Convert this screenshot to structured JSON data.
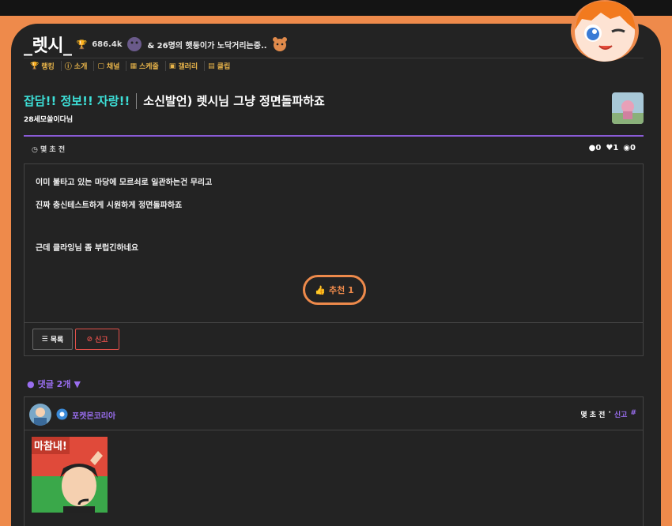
{
  "header": {
    "channel_name": "_렛시_",
    "follow_count": "686.4k",
    "viewers_text": "& 26명의 햇둥이가 노닥거리는중.."
  },
  "nav": [
    {
      "icon": "trophy-icon",
      "label": "랭킹"
    },
    {
      "icon": "info-icon",
      "label": "소개"
    },
    {
      "icon": "twitch-icon",
      "label": "채널"
    },
    {
      "icon": "calendar-icon",
      "label": "스케줄"
    },
    {
      "icon": "image-icon",
      "label": "갤러리"
    },
    {
      "icon": "film-icon",
      "label": "클립"
    }
  ],
  "post": {
    "category": "잡담!! 정보!! 자랑!!",
    "title": "소신발언) 렛시님 그냥 정면돌파하죠",
    "author": "28세모쏠이다님",
    "time": "몇 초 전",
    "comments_count": "0",
    "likes_count": "1",
    "views_count": "0",
    "lines": [
      "이미 불타고 있는 마당에 모르쇠로 일관하는건 무리고",
      "진짜 충신테스트하게 시원하게 정면돌파하죠",
      "근데 클라잉님 좀 부럽긴하네요"
    ],
    "recommend_label": "추천 1",
    "list_label": "목록",
    "report_label": "신고"
  },
  "comments": {
    "toggle_label": "댓글 2개",
    "items": [
      {
        "name": "포켓몬코리아",
        "time": "몇 초 전",
        "report_label": "신고",
        "image_caption": "마참내!"
      }
    ]
  },
  "colors": {
    "accent_orange": "#ee8a4b",
    "accent_teal": "#3de0d8",
    "accent_purple": "#9a6ef0",
    "nav_gold": "#e8b44a",
    "report_red": "#e0504a"
  }
}
